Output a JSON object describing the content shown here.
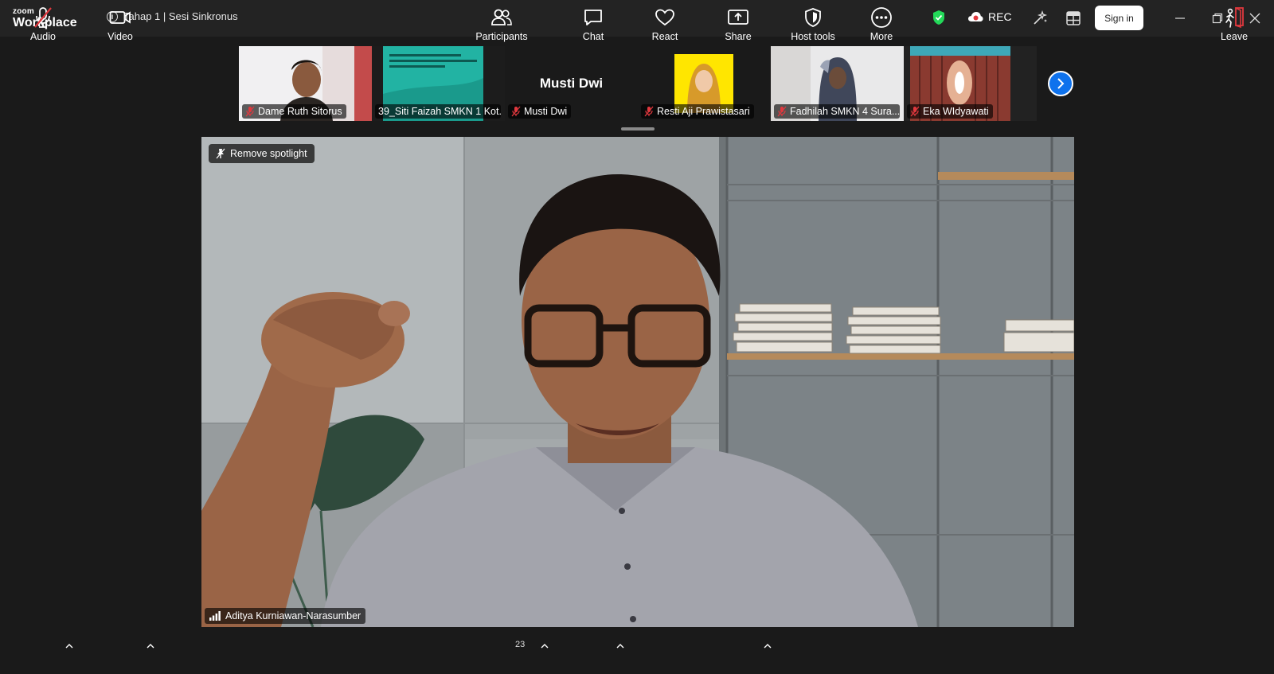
{
  "app": {
    "logo_small": "zoom",
    "logo_big": "Workplace",
    "meeting_title": "Tahap 1 | Sesi Sinkronus",
    "rec_label": "REC",
    "signin_label": "Sign in"
  },
  "colors": {
    "accent_blue": "#0e72ed",
    "secure_green": "#23d959",
    "muted_red": "#e0383e"
  },
  "thumbnails": [
    {
      "name": "Dame Ruth Sitorus",
      "muted": true
    },
    {
      "name": "39_Siti Faizah SMKN 1 Kot...",
      "muted": false
    },
    {
      "name": "Musti Dwi",
      "muted": true,
      "big_name": "Musti Dwi"
    },
    {
      "name": "Resti Aji Prawistasari",
      "muted": true
    },
    {
      "name": "Fadhilah SMKN 4 Sura...",
      "muted": true
    },
    {
      "name": "Eka WIdyawati",
      "muted": true
    }
  ],
  "main": {
    "spotlight_label": "Remove spotlight",
    "speaker_name": "Aditya Kurniawan-Narasumber"
  },
  "toolbar": {
    "audio": "Audio",
    "video": "Video",
    "participants": "Participants",
    "participants_count": "23",
    "chat": "Chat",
    "react": "React",
    "share": "Share",
    "host_tools": "Host tools",
    "more": "More",
    "leave": "Leave"
  },
  "icons": [
    "info-icon",
    "shield-check-icon",
    "cloud-record-icon",
    "ai-sparkle-icon",
    "apps-icon",
    "minimize-icon",
    "restore-icon",
    "close-icon",
    "mic-muted-icon",
    "camera-icon",
    "participants-icon",
    "chat-icon",
    "heart-icon",
    "share-screen-icon",
    "host-shield-icon",
    "more-dots-icon",
    "leave-door-icon",
    "pin-icon",
    "signal-icon",
    "chevron-right-icon",
    "caret-up-icon"
  ]
}
